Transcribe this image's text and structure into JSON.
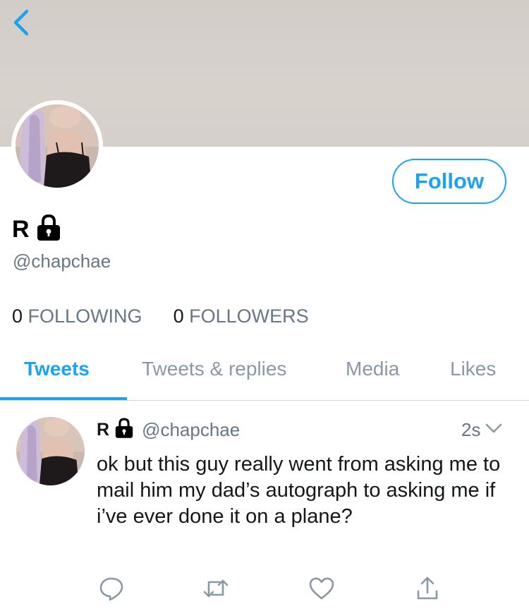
{
  "header": {
    "back_icon": "chevron-left-icon",
    "banner_color": "#d6d0cb"
  },
  "profile": {
    "display_name": "R",
    "protected_icon": "lock-icon",
    "handle": "@chapchae",
    "follow_label": "Follow",
    "following_count": "0",
    "following_label": "FOLLOWING",
    "followers_count": "0",
    "followers_label": "FOLLOWERS"
  },
  "tabs": [
    {
      "label": "Tweets",
      "active": true
    },
    {
      "label": "Tweets & replies",
      "active": false
    },
    {
      "label": "Media",
      "active": false
    },
    {
      "label": "Likes",
      "active": false
    }
  ],
  "tweet": {
    "name": "R",
    "handle": "@chapchae",
    "time": "2s",
    "text": "ok but this guy really went from asking me to mail him my dad’s autograph to asking me if i’ve ever done it on a plane?",
    "actions": [
      "reply-icon",
      "retweet-icon",
      "like-icon",
      "share-icon"
    ]
  },
  "colors": {
    "accent": "#1da1f2",
    "secondary_text": "#657786",
    "icon_gray": "#8899a6"
  }
}
